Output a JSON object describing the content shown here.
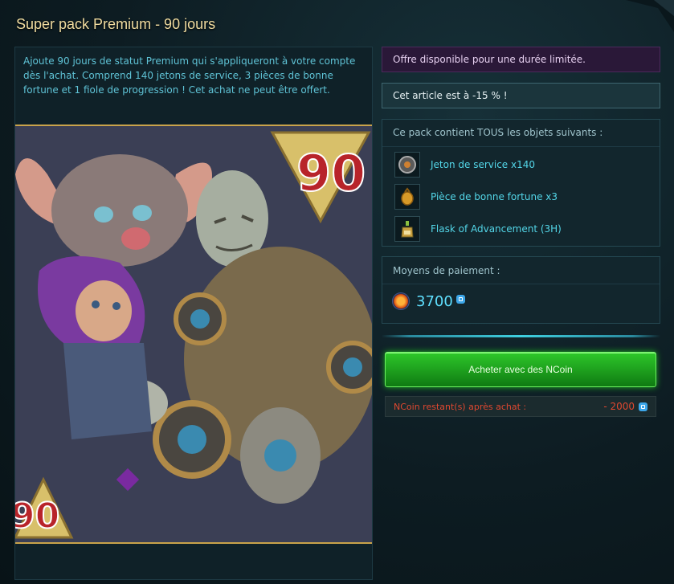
{
  "title": "Super pack Premium - 90 jours",
  "description": "Ajoute 90 jours de statut Premium qui s'appliqueront à votre compte dès l'achat. Comprend 140 jetons de service, 3 pièces de bonne fortune et 1 fiole de progression ! Cet achat ne peut être offert.",
  "art": {
    "badge_number": "90"
  },
  "offer_notice": "Offre disponible pour une durée limitée.",
  "discount_notice": "Cet article est à -15 % !",
  "pack": {
    "header": "Ce pack contient TOUS les objets suivants :",
    "items": [
      {
        "label": "Jeton de service x140",
        "icon": "service-token-icon"
      },
      {
        "label": "Pièce de bonne fortune x3",
        "icon": "fortune-coin-icon"
      },
      {
        "label": "Flask of Advancement (3H)",
        "icon": "flask-icon"
      }
    ]
  },
  "payment": {
    "header": "Moyens de paiement :",
    "price": "3700",
    "currency_icon": "ncoin-icon"
  },
  "buy_button": "Acheter avec des NCoin",
  "remaining": {
    "label": "NCoin restant(s) après achat :",
    "value": "- 2000"
  },
  "colors": {
    "accent": "#53d6e8",
    "buy_green": "#1db020",
    "warning_red": "#e04830",
    "title_gold": "#f0dca0"
  }
}
